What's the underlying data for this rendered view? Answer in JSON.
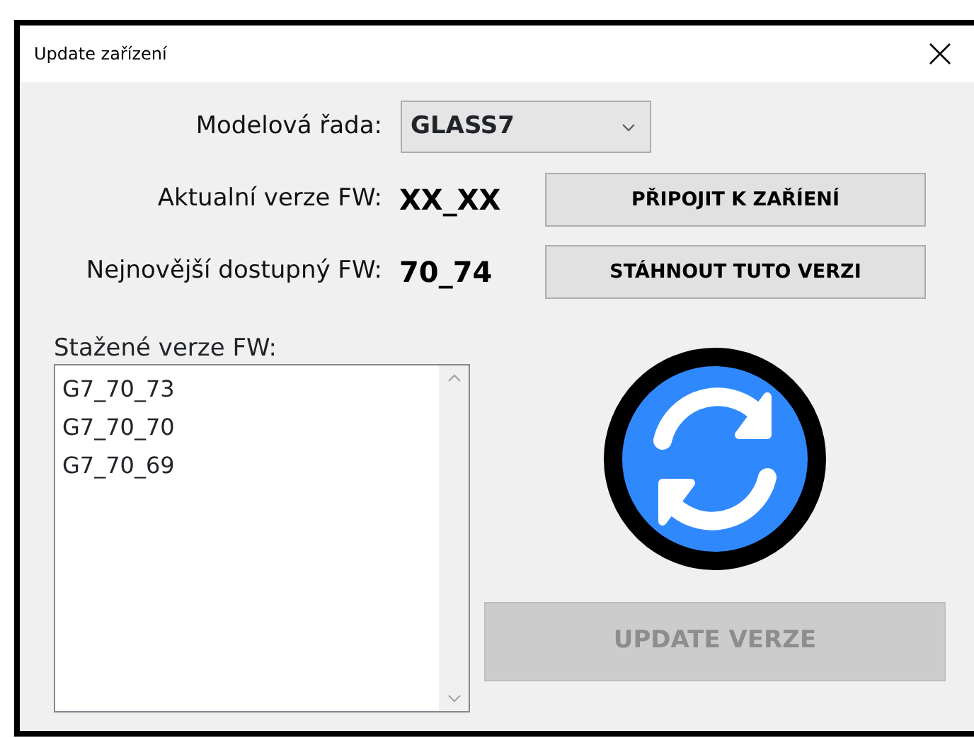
{
  "window": {
    "title": "Update zařízení"
  },
  "model_series": {
    "label": "Modelová řada:",
    "value": "GLASS7"
  },
  "current_fw": {
    "label": "Aktualní verze FW:",
    "value": "XX_XX"
  },
  "latest_fw": {
    "label": "Nejnovější dostupný FW:",
    "value": "70_74"
  },
  "buttons": [
    {
      "label": "PŘIPOJIT K ZAŘÍENÍ",
      "disabled": false
    },
    {
      "label": "STÁHNOUT TUTO VERZI",
      "disabled": false
    }
  ],
  "downloaded": {
    "label": "Stažené verze FW:",
    "items": [
      "G7_70_73",
      "G7_70_70",
      "G7_70_69"
    ]
  },
  "update_button": {
    "label": "UPDATE VERZE",
    "disabled": true
  }
}
